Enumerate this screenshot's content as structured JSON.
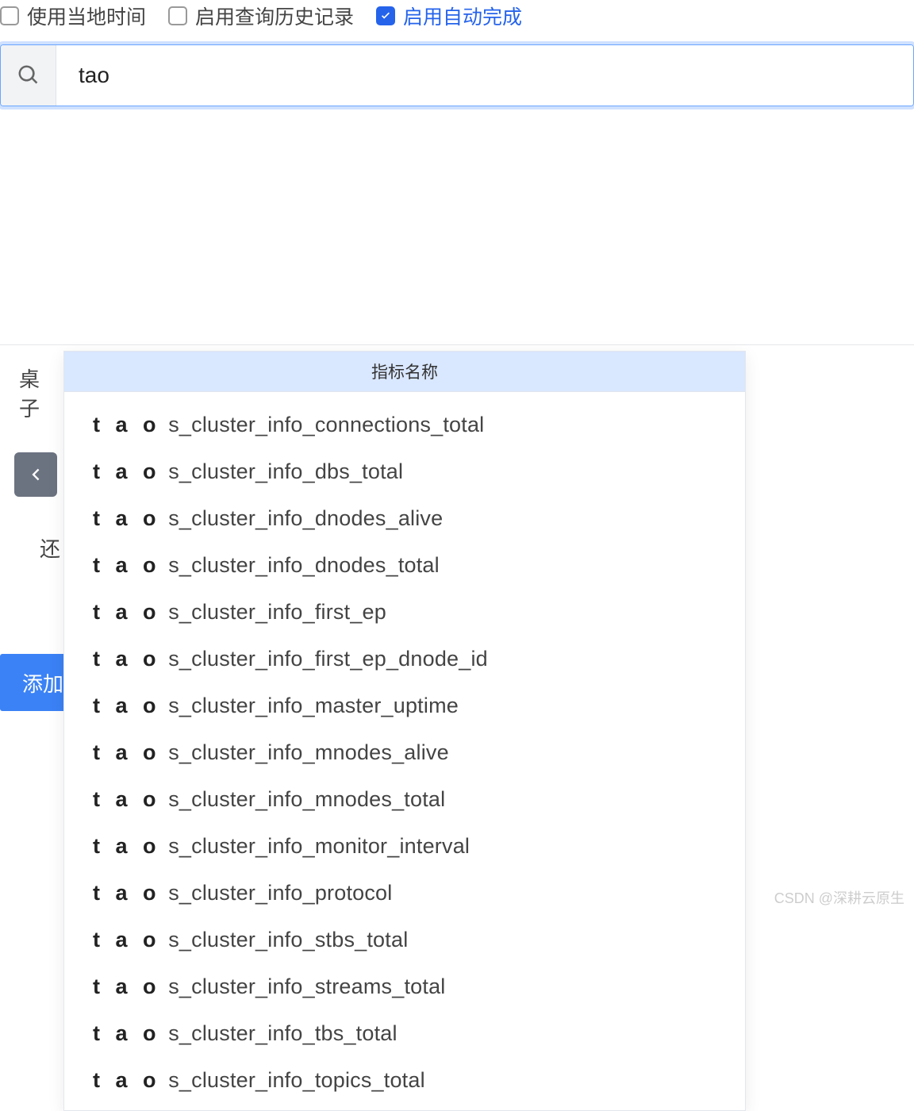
{
  "options": {
    "use_local_time": {
      "label": "使用当地时间",
      "checked": false
    },
    "enable_history": {
      "label": "启用查询历史记录",
      "checked": false
    },
    "enable_autocomplete": {
      "label": "启用自动完成",
      "checked": true
    }
  },
  "search": {
    "value": "tao",
    "placeholder": ""
  },
  "left": {
    "tab_label": "桌子",
    "more_label": "还",
    "add_button_label": "添加"
  },
  "autocomplete": {
    "header": "指标名称",
    "match_prefix": "tao",
    "items": [
      "s_cluster_info_connections_total",
      "s_cluster_info_dbs_total",
      "s_cluster_info_dnodes_alive",
      "s_cluster_info_dnodes_total",
      "s_cluster_info_first_ep",
      "s_cluster_info_first_ep_dnode_id",
      "s_cluster_info_master_uptime",
      "s_cluster_info_mnodes_alive",
      "s_cluster_info_mnodes_total",
      "s_cluster_info_monitor_interval",
      "s_cluster_info_protocol",
      "s_cluster_info_stbs_total",
      "s_cluster_info_streams_total",
      "s_cluster_info_tbs_total",
      "s_cluster_info_topics_total"
    ]
  },
  "watermark": "CSDN @深耕云原生"
}
